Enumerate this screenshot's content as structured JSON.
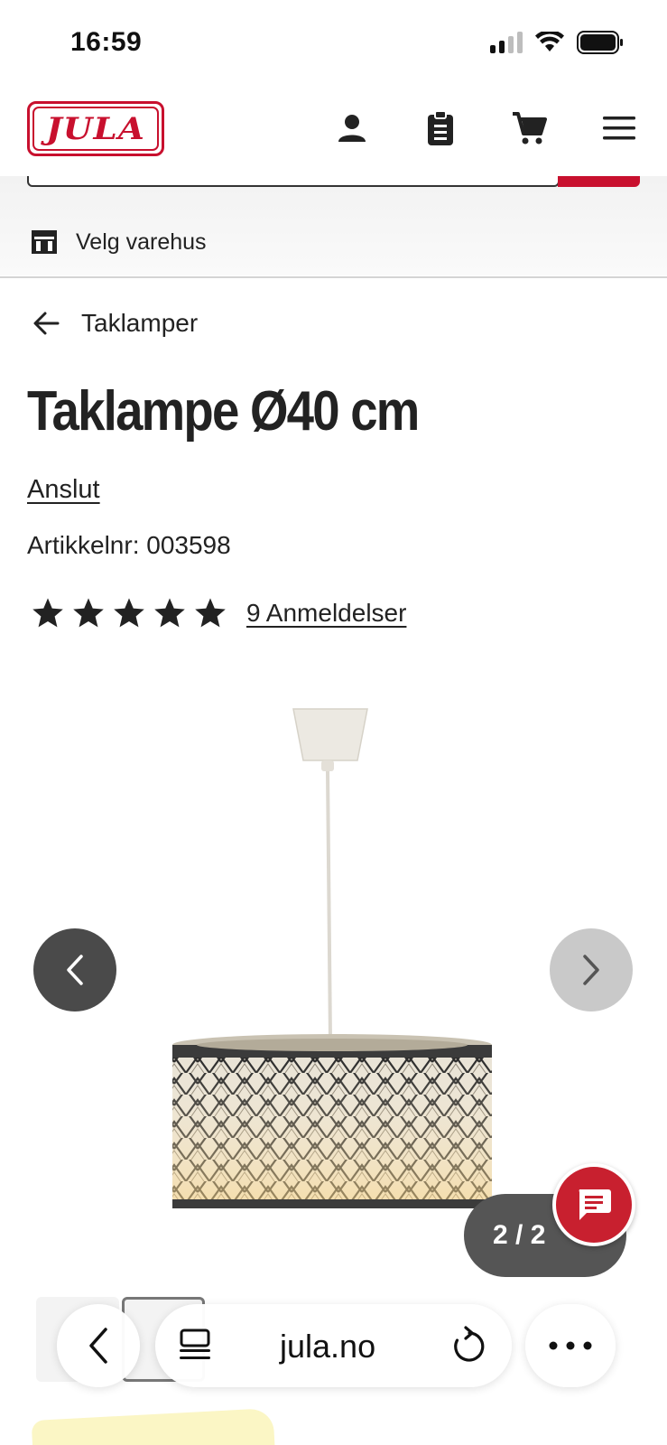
{
  "status_bar": {
    "time": "16:59",
    "icons": [
      "signal-icon",
      "wifi-icon",
      "battery-icon"
    ]
  },
  "header": {
    "logo_text": "JULA",
    "icons": [
      "account-icon",
      "clipboard-list-icon",
      "cart-icon",
      "menu-icon"
    ]
  },
  "store": {
    "label": "Velg varehus",
    "icon": "store-icon"
  },
  "breadcrumb": {
    "label": "Taklamper",
    "icon": "arrow-left-icon"
  },
  "product": {
    "title": "Taklampe Ø40 cm",
    "brand": "Anslut",
    "article_number": "Artikkelnr: 003598",
    "rating": 5,
    "rating_max": 5,
    "reviews_label": "9 Anmeldelser"
  },
  "gallery": {
    "counter": "2 / 2",
    "current": 2,
    "total": 2
  },
  "colors": {
    "brand_red": "#c8102e",
    "text": "#222222",
    "nav_dark": "#4a4a4a",
    "nav_light": "#c9c9c9"
  },
  "browser": {
    "url": "jula.no"
  }
}
